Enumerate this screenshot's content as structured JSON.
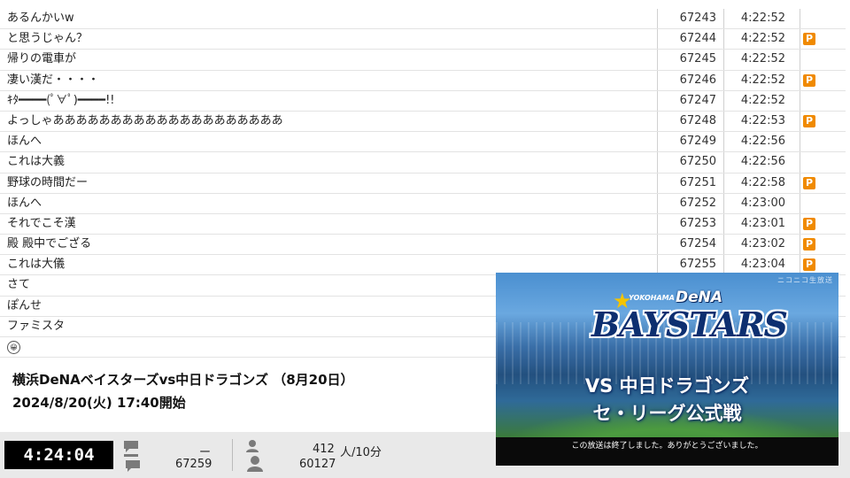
{
  "comments": [
    {
      "text": "あるんかいw",
      "no": "67243",
      "time": "4:22:52",
      "premium": false,
      "emoji": false
    },
    {
      "text": "と思うじゃん？",
      "no": "67244",
      "time": "4:22:52",
      "premium": true,
      "emoji": false
    },
    {
      "text": "帰りの電車が",
      "no": "67245",
      "time": "4:22:52",
      "premium": false,
      "emoji": false
    },
    {
      "text": "凄い漢だ・・・・",
      "no": "67246",
      "time": "4:22:52",
      "premium": true,
      "emoji": false
    },
    {
      "text": "ｷﾀ━━━━(ﾟ∀ﾟ)━━━━!!",
      "no": "67247",
      "time": "4:22:52",
      "premium": false,
      "emoji": false
    },
    {
      "text": "よっしゃああああああああああああああああああああ",
      "no": "67248",
      "time": "4:22:53",
      "premium": true,
      "emoji": false
    },
    {
      "text": "ほんへ",
      "no": "67249",
      "time": "4:22:56",
      "premium": false,
      "emoji": false
    },
    {
      "text": "これは大義",
      "no": "67250",
      "time": "4:22:56",
      "premium": false,
      "emoji": false
    },
    {
      "text": "野球の時間だー",
      "no": "67251",
      "time": "4:22:58",
      "premium": true,
      "emoji": false
    },
    {
      "text": "ほんへ",
      "no": "67252",
      "time": "4:23:00",
      "premium": false,
      "emoji": false
    },
    {
      "text": "それでこそ漢",
      "no": "67253",
      "time": "4:23:01",
      "premium": true,
      "emoji": false
    },
    {
      "text": "殿 殿中でござる",
      "no": "67254",
      "time": "4:23:02",
      "premium": true,
      "emoji": false
    },
    {
      "text": "これは大儀",
      "no": "67255",
      "time": "4:23:04",
      "premium": true,
      "emoji": false
    },
    {
      "text": "さて",
      "no": "",
      "time": "",
      "premium": false,
      "emoji": false
    },
    {
      "text": "ぽんせ",
      "no": "",
      "time": "",
      "premium": false,
      "emoji": false
    },
    {
      "text": "ファミスタ",
      "no": "",
      "time": "",
      "premium": false,
      "emoji": false
    },
    {
      "text": "",
      "no": "",
      "time": "",
      "premium": false,
      "emoji": true
    }
  ],
  "premium_label": "P",
  "emoji_glyph": "😀",
  "program": {
    "title": "横浜DeNAベイスターズvs中日ドラゴンズ （8月20日）",
    "datetime": "2024/8/20(火) 17:40開始"
  },
  "status": {
    "elapsed": "4:24:04",
    "comment_dash": "ー",
    "comment_count": "67259",
    "viewers_now": "412",
    "viewers_unit": "人/10分",
    "viewers_total": "60127"
  },
  "player": {
    "watermark": "ニコニコ生放送",
    "team_small": "YOKOHAMA",
    "team_dena": "DeNA",
    "team_main": "BAYSTARS",
    "line1": "VS 中日ドラゴンズ",
    "line2": "セ・リーグ公式戦",
    "ended_message": "この放送は終了しました。ありがとうございました。"
  },
  "colors": {
    "premium_badge": "#f08a00",
    "clock_bg": "#000000",
    "statusbar_bg": "#e9e9e9",
    "team_navy": "#0d2f70"
  },
  "icons": [
    "comment-icon",
    "user-icon",
    "chevron-down-icon",
    "star-icon"
  ]
}
